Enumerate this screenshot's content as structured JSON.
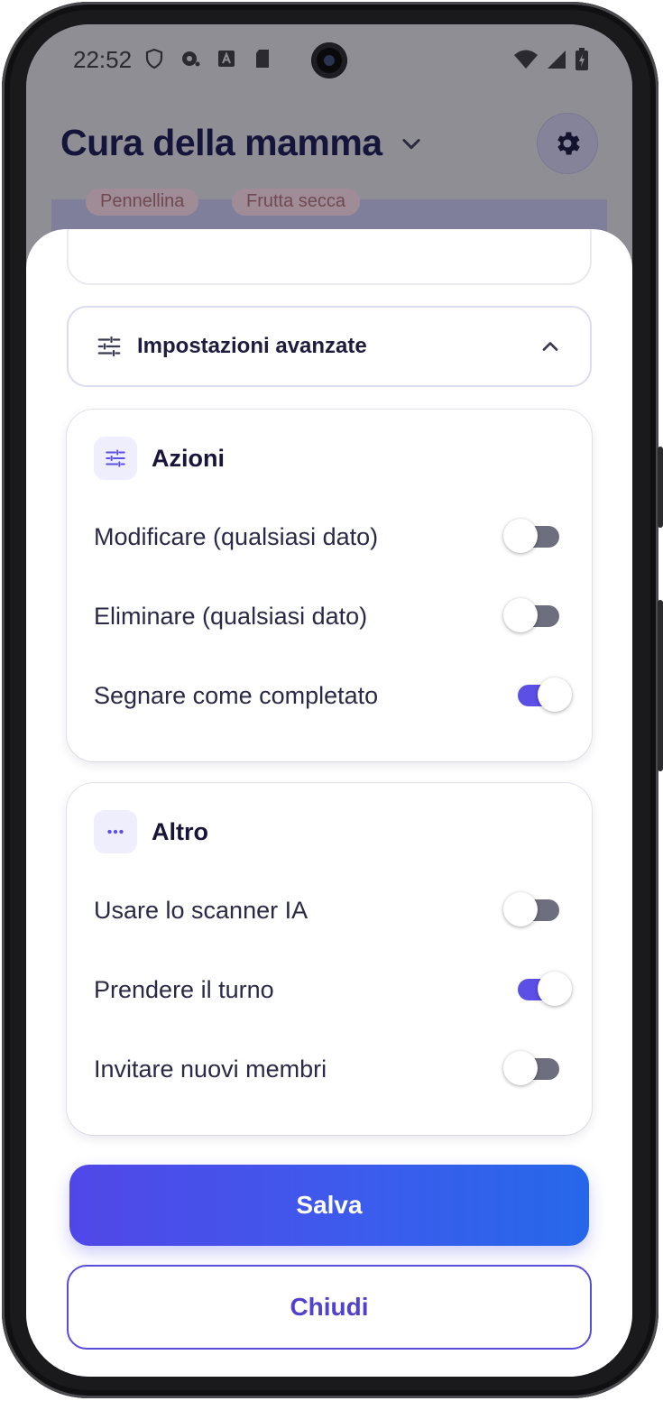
{
  "status_bar": {
    "time": "22:52",
    "left_icons": [
      "shield-icon",
      "notification-icon",
      "font-a-icon",
      "sd-card-icon"
    ],
    "right_icons": [
      "wifi-icon",
      "signal-icon",
      "battery-charging-icon"
    ]
  },
  "app_header": {
    "title": "Cura della mamma",
    "title_icon": "chevron-down-icon",
    "settings_icon": "gear-icon"
  },
  "background_chips": [
    "Pennellina",
    "Frutta secca"
  ],
  "sheet": {
    "advanced": {
      "title": "Impostazioni avanzate",
      "icon": "tune-icon",
      "expanded": true,
      "chevron_icon": "chevron-up-icon"
    },
    "sections": [
      {
        "title": "Azioni",
        "icon": "tune-icon",
        "toggles": [
          {
            "label": "Modificare (qualsiasi dato)",
            "on": false
          },
          {
            "label": "Eliminare (qualsiasi dato)",
            "on": false
          },
          {
            "label": "Segnare come completato",
            "on": true
          }
        ]
      },
      {
        "title": "Altro",
        "icon": "more-horizontal-icon",
        "toggles": [
          {
            "label": "Usare lo scanner IA",
            "on": false
          },
          {
            "label": "Prendere il turno",
            "on": true
          },
          {
            "label": "Invitare nuovi membri",
            "on": false
          }
        ]
      }
    ],
    "save_label": "Salva",
    "close_label": "Chiudi"
  },
  "colors": {
    "accent": "#5b4fe6",
    "gradient_start": "#5147e8",
    "gradient_end": "#2667ea",
    "switch_off": "#6d6f7e",
    "title_text": "#15143a"
  }
}
